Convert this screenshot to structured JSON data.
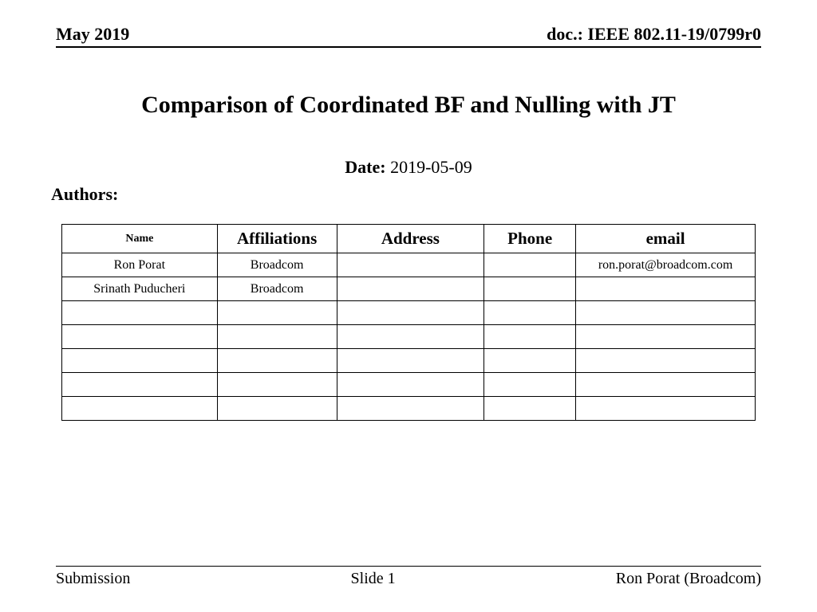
{
  "header": {
    "date_header": "May 2019",
    "doc_id": "doc.: IEEE 802.11-19/0799r0"
  },
  "title": "Comparison of Coordinated BF and Nulling with JT",
  "date": {
    "label": "Date:",
    "value": "2019-05-09"
  },
  "authors_label": "Authors:",
  "table": {
    "headers": {
      "name": "Name",
      "affiliations": "Affiliations",
      "address": "Address",
      "phone": "Phone",
      "email": "email"
    },
    "rows": [
      {
        "name": "Ron Porat",
        "affiliations": "Broadcom",
        "address": "",
        "phone": "",
        "email": "ron.porat@broadcom.com"
      },
      {
        "name": "Srinath Puducheri",
        "affiliations": "Broadcom",
        "address": "",
        "phone": "",
        "email": ""
      },
      {
        "name": "",
        "affiliations": "",
        "address": "",
        "phone": "",
        "email": ""
      },
      {
        "name": "",
        "affiliations": "",
        "address": "",
        "phone": "",
        "email": ""
      },
      {
        "name": "",
        "affiliations": "",
        "address": "",
        "phone": "",
        "email": ""
      },
      {
        "name": "",
        "affiliations": "",
        "address": "",
        "phone": "",
        "email": ""
      },
      {
        "name": "",
        "affiliations": "",
        "address": "",
        "phone": "",
        "email": ""
      }
    ]
  },
  "footer": {
    "left": "Submission",
    "center": "Slide 1",
    "right": "Ron Porat (Broadcom)"
  }
}
